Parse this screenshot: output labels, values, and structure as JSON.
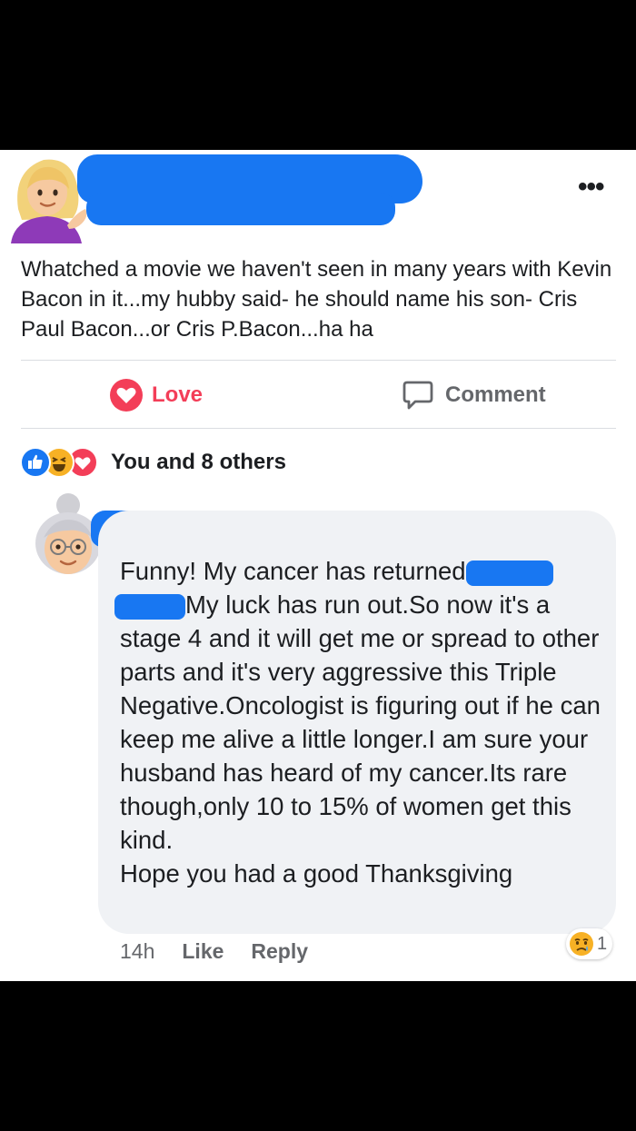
{
  "post": {
    "text": "Whatched a movie we haven't seen in many years with Kevin Bacon in it...my hubby said- he should name his son- Cris Paul Bacon...or Cris P.Bacon...ha ha",
    "more_label": "•••"
  },
  "actions": {
    "love_label": "Love",
    "comment_label": "Comment"
  },
  "reactions": {
    "icons": [
      "like-icon",
      "haha-icon",
      "love-icon"
    ],
    "summary": "You and 8 others"
  },
  "comment": {
    "text_before_redaction": "Funny! My cancer has returned",
    "text_after_redaction": "My luck has run out.So now it's a stage 4 and it will get me or spread to other parts and it's very aggressive this Triple Negative.Oncologist is figuring out if he can keep me alive a little longer.I am sure your husband has heard of my cancer.Its rare though,only 10 to 15% of women get this kind.",
    "closing_line": "Hope you had a good Thanksgiving",
    "time": "14h",
    "like_label": "Like",
    "reply_label": "Reply",
    "reaction_count": "1"
  },
  "colors": {
    "redaction": "#1877f2",
    "love": "#f33e58",
    "like": "#1877f2",
    "haha": "#f7b125",
    "bubble": "#f0f2f5"
  }
}
